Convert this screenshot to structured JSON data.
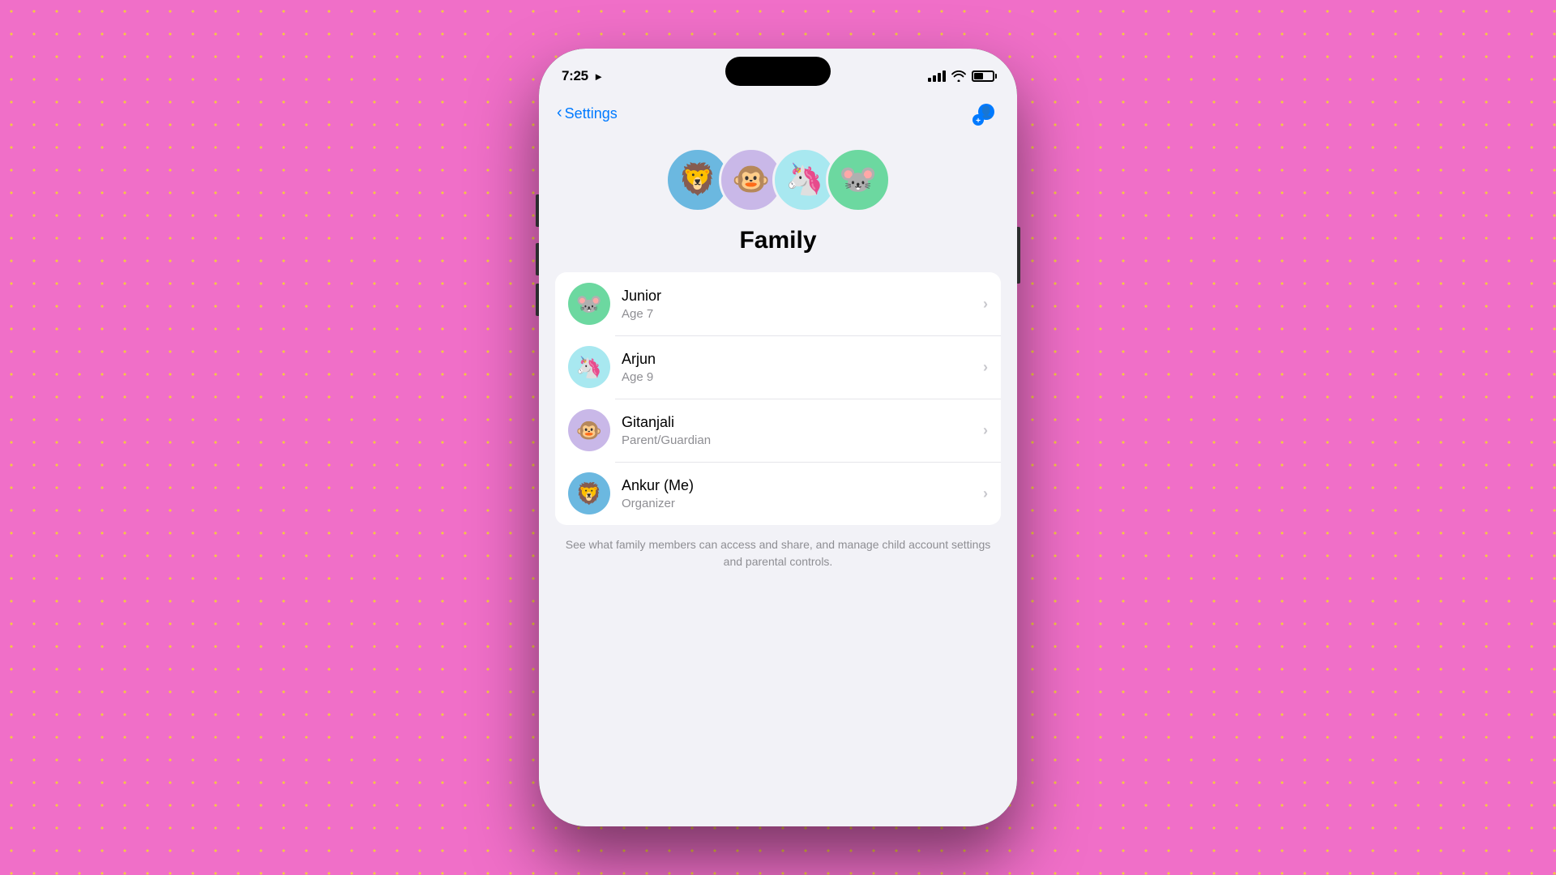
{
  "statusBar": {
    "time": "7:25",
    "locationIcon": "▶"
  },
  "nav": {
    "backLabel": "Settings",
    "addMemberLabel": "Add Family Member"
  },
  "avatarGroup": [
    {
      "emoji": "🦁",
      "colorClass": "lion",
      "name": "lion-avatar"
    },
    {
      "emoji": "🐵",
      "colorClass": "monkey",
      "name": "monkey-avatar"
    },
    {
      "emoji": "🦄",
      "colorClass": "unicorn",
      "name": "unicorn-avatar"
    },
    {
      "emoji": "🐭",
      "colorClass": "mouse",
      "name": "mouse-avatar"
    }
  ],
  "pageTitle": "Family",
  "familyMembers": [
    {
      "name": "Junior",
      "role": "Age 7",
      "emoji": "🐭",
      "avatarClass": "mouse-bg"
    },
    {
      "name": "Arjun",
      "role": "Age 9",
      "emoji": "🦄",
      "avatarClass": "unicorn-bg"
    },
    {
      "name": "Gitanjali",
      "role": "Parent/Guardian",
      "emoji": "🐵",
      "avatarClass": "monkey-bg"
    },
    {
      "name": "Ankur (Me)",
      "role": "Organizer",
      "emoji": "🦁",
      "avatarClass": "lion-bg"
    }
  ],
  "footerText": "See what family members can access and share, and manage child account settings and parental controls."
}
